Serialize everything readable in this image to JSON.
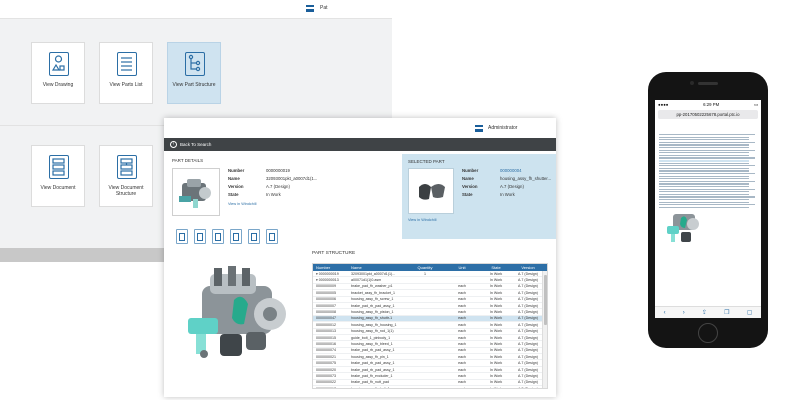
{
  "back_window": {
    "user_label": "Pat",
    "tiles": [
      {
        "label": "View Drawing",
        "icon": "drawing-icon"
      },
      {
        "label": "View Parts List",
        "icon": "parts-list-icon"
      },
      {
        "label": "View Part Structure",
        "icon": "part-structure-icon",
        "active": true
      },
      {
        "label": "View Document",
        "icon": "document-icon"
      },
      {
        "label": "View Document Structure",
        "icon": "document-structure-icon"
      }
    ]
  },
  "front_window": {
    "user_label": "Administrator",
    "back_label": "Back To Search",
    "part_details": {
      "title": "PART DETAILS",
      "fields": [
        {
          "key": "Number",
          "value": "0000000019"
        },
        {
          "key": "Name",
          "value": "32093001pkt_a0007d1(1..."
        },
        {
          "key": "Version",
          "value": "A.7 (Design)"
        },
        {
          "key": "State",
          "value": "In Work"
        }
      ],
      "view_details": "View in Windchill"
    },
    "selected_part": {
      "title": "SELECTED PART",
      "fields": [
        {
          "key": "Number",
          "value": "000000004"
        },
        {
          "key": "Name",
          "value": "housing_assy_fh_shutter..."
        },
        {
          "key": "Version",
          "value": "A.7 (Design)"
        },
        {
          "key": "State",
          "value": "In Work"
        }
      ],
      "view_details": "View in Windchill"
    },
    "part_structure": {
      "title": "PART STRUCTURE",
      "columns": [
        "Number",
        "Name",
        "Quantity",
        "Unit",
        "State",
        "Version"
      ],
      "rows": [
        {
          "number": "▾ 0000000019",
          "name": "32093001pkt_a0007d1(1)...",
          "qty": "1",
          "unit": "",
          "state": "In Work",
          "version": "A.7 (Design)"
        },
        {
          "number": "▾ 0000000013",
          "name": "a00071d1(1)0.asm",
          "qty": "",
          "unit": "",
          "state": "In Work",
          "version": "A.7 (Design)"
        },
        {
          "number": "0000000009",
          "name": "brake_pad_fh_washer_p1",
          "qty": "",
          "unit": "each",
          "state": "In Work",
          "version": "A.7 (Design)"
        },
        {
          "number": "0000000005",
          "name": "bracket_assy_fh_bracket_1",
          "qty": "",
          "unit": "each",
          "state": "In Work",
          "version": "A.7 (Design)"
        },
        {
          "number": "0000000006",
          "name": "housing_assy_fh_screw_1",
          "qty": "",
          "unit": "each",
          "state": "In Work",
          "version": "A.7 (Design)"
        },
        {
          "number": "0000000007",
          "name": "brake_pad_rb_pad_assy_1",
          "qty": "",
          "unit": "each",
          "state": "In Work",
          "version": "A.7 (Design)"
        },
        {
          "number": "0000000008",
          "name": "housing_assy_fh_piston_1",
          "qty": "",
          "unit": "each",
          "state": "In Work",
          "version": "A.7 (Design)"
        },
        {
          "number": "0000000047",
          "name": "housing_assy_fh_shuttr-1",
          "qty": "",
          "unit": "each",
          "state": "In Work",
          "version": "A.7 (Design)",
          "selected": true
        },
        {
          "number": "0000000012",
          "name": "housing_assy_fh_housing_1",
          "qty": "",
          "unit": "each",
          "state": "In Work",
          "version": "A.7 (Design)"
        },
        {
          "number": "0000000013",
          "name": "housing_assy_fh_rod_1(1)",
          "qty": "",
          "unit": "each",
          "state": "In Work",
          "version": "A.7 (Design)"
        },
        {
          "number": "0000000015",
          "name": "guide_bolt_1_pinbody_1",
          "qty": "",
          "unit": "each",
          "state": "In Work",
          "version": "A.7 (Design)"
        },
        {
          "number": "0000000016",
          "name": "housing_assy_fh_bleed_1",
          "qty": "",
          "unit": "each",
          "state": "In Work",
          "version": "A.7 (Design)"
        },
        {
          "number": "0000000074",
          "name": "brake_pad_rb_pad_assy_1",
          "qty": "",
          "unit": "each",
          "state": "In Work",
          "version": "A.7 (Design)"
        },
        {
          "number": "0000000021",
          "name": "housing_assy_fh_pin_1",
          "qty": "",
          "unit": "each",
          "state": "In Work",
          "version": "A.7 (Design)"
        },
        {
          "number": "0000000075",
          "name": "brake_pad_rb_pad_assy_1",
          "qty": "",
          "unit": "each",
          "state": "In Work",
          "version": "A.7 (Design)"
        },
        {
          "number": "0000000020",
          "name": "brake_pad_rb_pad_assy_1",
          "qty": "",
          "unit": "each",
          "state": "In Work",
          "version": "A.7 (Design)"
        },
        {
          "number": "0000000073",
          "name": "brake_pad_fh_excluder_1",
          "qty": "",
          "unit": "each",
          "state": "In Work",
          "version": "A.7 (Design)"
        },
        {
          "number": "0000000022",
          "name": "brake_pad_fh_nutt_pad",
          "qty": "",
          "unit": "each",
          "state": "In Work",
          "version": "A.7 (Design)"
        },
        {
          "number": "0000000017",
          "name": "housing_assy_fh_bolt_1",
          "qty": "",
          "unit": "each",
          "state": "In Work",
          "version": "A.7 (Design)"
        },
        {
          "number": "0000000014",
          "name": "housing_assy_fh_actuat_1",
          "qty": "",
          "unit": "each",
          "state": "In Work",
          "version": "A.7 (Design)"
        },
        {
          "number": "0000000003",
          "name": "bracket_assy_fh_guide_1",
          "qty": "",
          "unit": "each",
          "state": "In Work",
          "version": "A.7 (Design)"
        }
      ]
    }
  },
  "phone": {
    "status_time": "6:29 PM",
    "url": "pp-20170502225678.portal.ptc.io",
    "toolbar_icons": [
      "back-icon",
      "forward-icon",
      "share-icon",
      "bookmarks-icon",
      "tabs-icon"
    ]
  },
  "colors": {
    "accent": "#2d6fa7",
    "selected_panel": "#cde3ef",
    "dark_bar": "#3f4346"
  }
}
